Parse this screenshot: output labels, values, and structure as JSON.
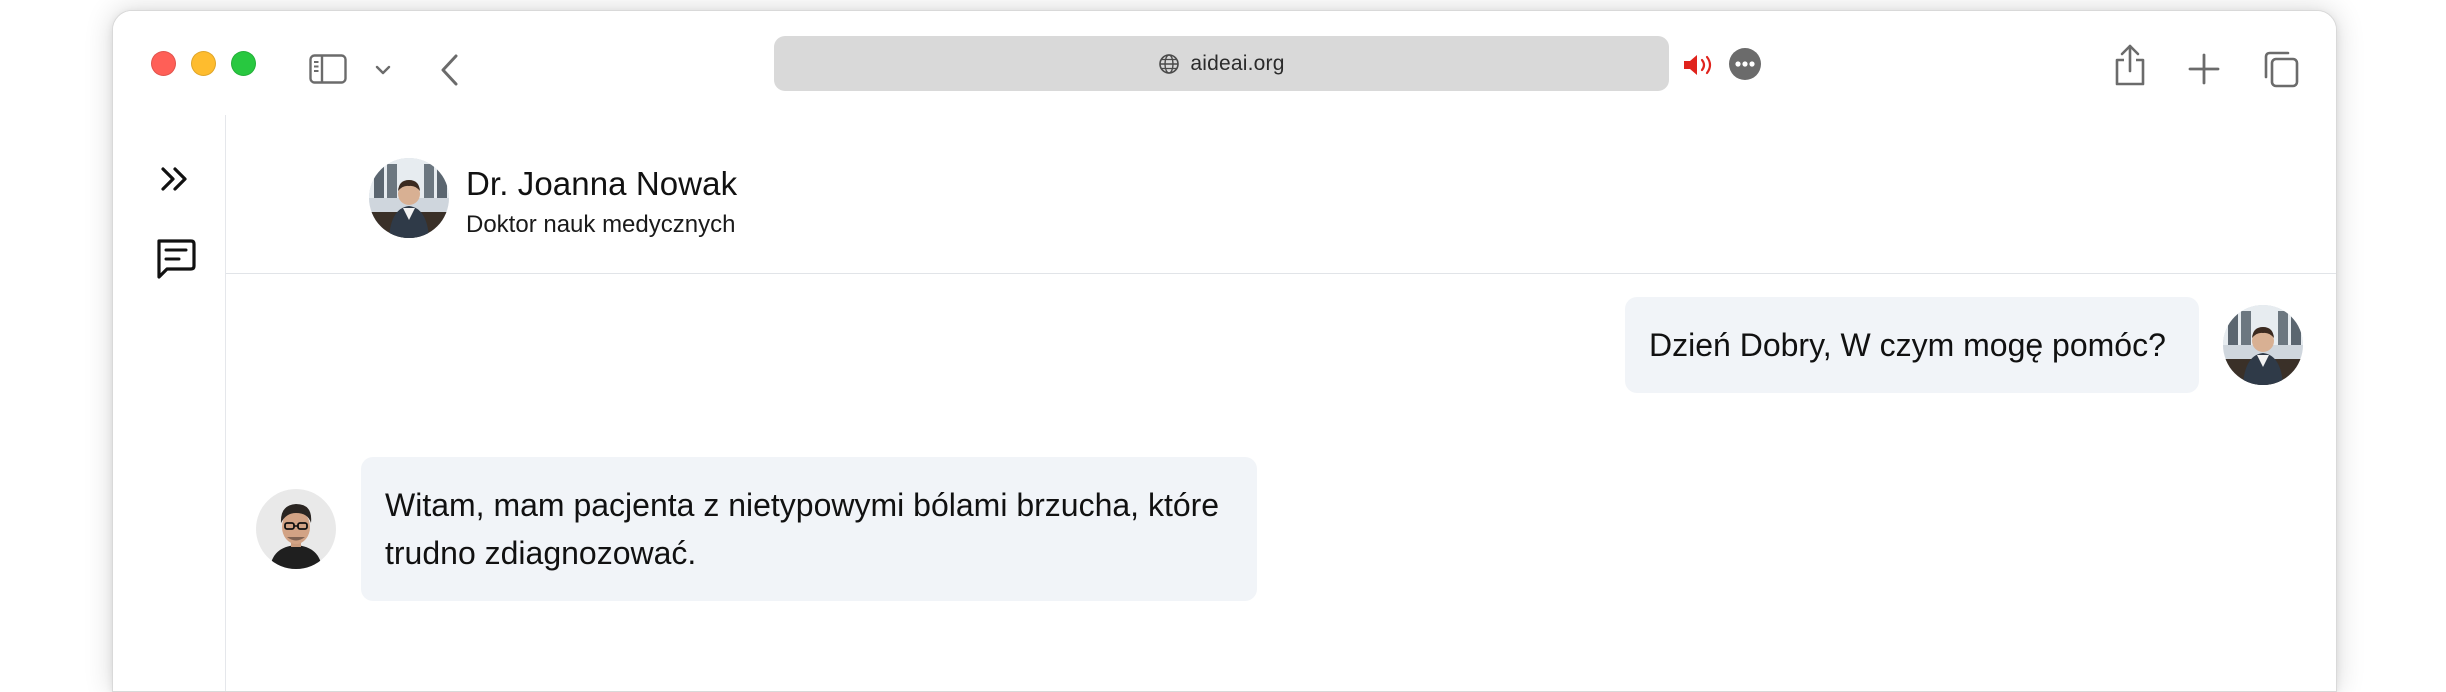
{
  "browser": {
    "url": "aideai.org",
    "colors": {
      "close": "#ff5f57",
      "minimize": "#febc2e",
      "zoom": "#28c840",
      "audio_active": "#e0231c",
      "address_bg": "#d9d9d9"
    },
    "icons": {
      "sidebar_toggle": "sidebar-icon",
      "dropdown": "chevron-down-icon",
      "back": "chevron-left-icon",
      "site": "globe-icon",
      "audio": "speaker-icon",
      "page_menu": "ellipsis-icon",
      "share": "share-icon",
      "new_tab": "plus-icon",
      "tabs": "tabs-overview-icon"
    }
  },
  "sidebar": {
    "icons": [
      "expand-double-chevron-icon",
      "chat-icon"
    ]
  },
  "chat": {
    "header": {
      "name": "Dr. Joanna Nowak",
      "subtitle": "Doktor nauk medycznych"
    },
    "messages": [
      {
        "side": "right",
        "text": "Dzień Dobry, W czym mogę pomóc?"
      },
      {
        "side": "left",
        "text": "Witam, mam pacjenta z nietypowymi bólami brzucha, które trudno zdiagnozować."
      }
    ],
    "colors": {
      "bubble_bg": "#f1f4f8",
      "divider": "#e1e4e8"
    }
  }
}
